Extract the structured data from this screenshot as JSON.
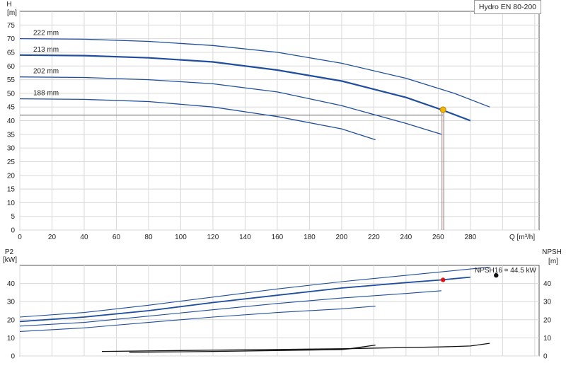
{
  "chart_data": [
    {
      "type": "line",
      "title": "",
      "xlabel": "Q [m³/h]",
      "ylabel": "H",
      "ylabel_unit": "[m]",
      "xlim": [
        0,
        320
      ],
      "ylim": [
        0,
        80
      ],
      "xticks": [
        0,
        20,
        40,
        60,
        80,
        100,
        120,
        140,
        160,
        180,
        200,
        220,
        240,
        260,
        280
      ],
      "yticks": [
        0,
        5,
        10,
        15,
        20,
        25,
        30,
        35,
        40,
        45,
        50,
        55,
        60,
        65,
        70,
        75
      ],
      "grid": true,
      "legend_label": "Hydro EN 80-200",
      "series": [
        {
          "name": "222 mm",
          "points": [
            [
              0,
              70
            ],
            [
              40,
              69.8
            ],
            [
              80,
              69
            ],
            [
              120,
              67.5
            ],
            [
              160,
              65
            ],
            [
              200,
              61
            ],
            [
              240,
              55.5
            ],
            [
              270,
              50
            ],
            [
              292,
              45
            ]
          ]
        },
        {
          "name": "213 mm",
          "points": [
            [
              0,
              64
            ],
            [
              40,
              63.8
            ],
            [
              80,
              63
            ],
            [
              120,
              61.5
            ],
            [
              160,
              58.5
            ],
            [
              200,
              54.5
            ],
            [
              240,
              48.5
            ],
            [
              262,
              44
            ],
            [
              280,
              40
            ]
          ]
        },
        {
          "name": "202 mm",
          "points": [
            [
              0,
              56
            ],
            [
              40,
              55.8
            ],
            [
              80,
              55
            ],
            [
              120,
              53.5
            ],
            [
              160,
              50.5
            ],
            [
              200,
              45.5
            ],
            [
              240,
              39
            ],
            [
              262,
              35
            ]
          ]
        },
        {
          "name": "188 mm",
          "points": [
            [
              0,
              48
            ],
            [
              40,
              47.8
            ],
            [
              80,
              47
            ],
            [
              120,
              45
            ],
            [
              160,
              41.5
            ],
            [
              200,
              37
            ],
            [
              221,
              33
            ]
          ]
        }
      ],
      "duty_point": {
        "x": 263,
        "y": 44
      },
      "duty_level": 42
    },
    {
      "type": "line",
      "xlim": [
        0,
        320
      ],
      "ylim": [
        0,
        50
      ],
      "ylabel_left": "P2",
      "ylabel_left_unit": "[kW]",
      "ylabel_right": "NPSH",
      "ylabel_right_unit": "[m]",
      "yticks": [
        0,
        10,
        20,
        30,
        40
      ],
      "grid": true,
      "annotation": "NPSH16 = 44.5 kW",
      "power_series": [
        {
          "name": "222 mm",
          "points": [
            [
              0,
              21.5
            ],
            [
              40,
              24
            ],
            [
              80,
              28
            ],
            [
              120,
              32.5
            ],
            [
              160,
              37
            ],
            [
              200,
              41
            ],
            [
              240,
              44.5
            ],
            [
              280,
              48
            ],
            [
              292,
              49
            ]
          ]
        },
        {
          "name": "213 mm",
          "points": [
            [
              0,
              19
            ],
            [
              40,
              21.5
            ],
            [
              80,
              25
            ],
            [
              120,
              29.5
            ],
            [
              160,
              33.5
            ],
            [
              200,
              37.5
            ],
            [
              240,
              40.5
            ],
            [
              262,
              42
            ],
            [
              280,
              43.5
            ]
          ]
        },
        {
          "name": "202 mm",
          "points": [
            [
              0,
              16.5
            ],
            [
              40,
              18.5
            ],
            [
              80,
              22
            ],
            [
              120,
              25.5
            ],
            [
              160,
              29
            ],
            [
              200,
              32
            ],
            [
              240,
              34.5
            ],
            [
              262,
              36
            ]
          ]
        },
        {
          "name": "188 mm",
          "points": [
            [
              0,
              13.5
            ],
            [
              40,
              15.5
            ],
            [
              80,
              18.5
            ],
            [
              120,
              21.5
            ],
            [
              160,
              24
            ],
            [
              200,
              26
            ],
            [
              221,
              27.5
            ]
          ]
        }
      ],
      "npsh_series": [
        {
          "points": [
            [
              51,
              2.5
            ],
            [
              100,
              3
            ],
            [
              150,
              3.5
            ],
            [
              200,
              4
            ],
            [
              230,
              4.5
            ],
            [
              262,
              5
            ],
            [
              280,
              5.5
            ],
            [
              292,
              7
            ]
          ]
        },
        {
          "points": [
            [
              68,
              2
            ],
            [
              120,
              2.5
            ],
            [
              160,
              3
            ],
            [
              200,
              3.5
            ],
            [
              205,
              4
            ],
            [
              221,
              6
            ]
          ]
        }
      ],
      "power_point": {
        "x": 263,
        "y": 42
      },
      "npsh_point": {
        "x": 296,
        "y": 44.5
      },
      "colors": {
        "curve": "#1f4e9c",
        "duty_point": "#f2b600",
        "power_point": "#e01010",
        "npsh_point": "#111111",
        "grid": "#d8d8d8",
        "axis": "#555555"
      }
    }
  ]
}
